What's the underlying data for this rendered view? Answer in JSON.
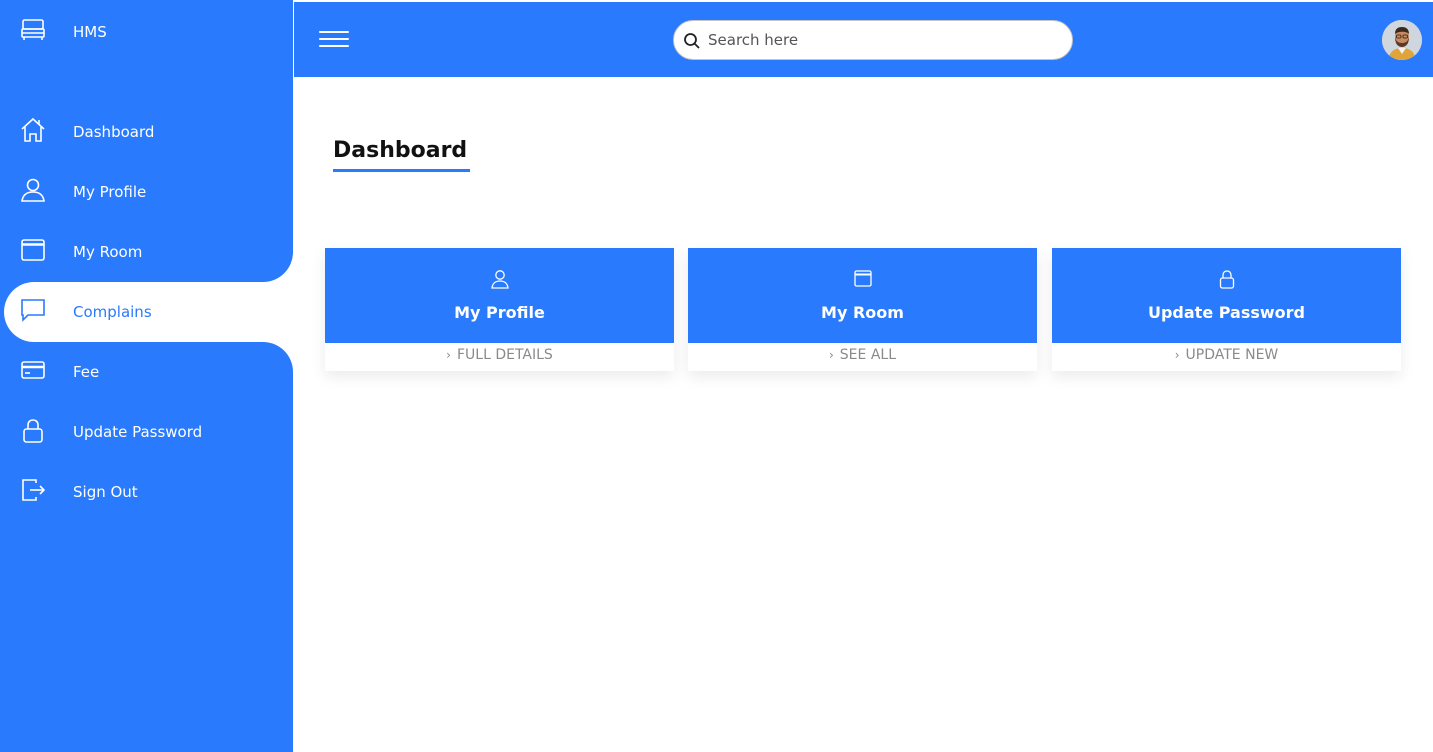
{
  "sidebar": {
    "brand": {
      "label": "HMS",
      "icon": "bed-icon"
    },
    "items": [
      {
        "label": "Dashboard",
        "icon": "home-icon"
      },
      {
        "label": "My Profile",
        "icon": "person-icon"
      },
      {
        "label": "My Room",
        "icon": "window-icon"
      },
      {
        "label": "Complains",
        "icon": "chat-icon",
        "active": true
      },
      {
        "label": "Fee",
        "icon": "credit-card-icon"
      },
      {
        "label": "Update Password",
        "icon": "lock-icon"
      },
      {
        "label": "Sign Out",
        "icon": "sign-out-icon"
      }
    ]
  },
  "topbar": {
    "search": {
      "placeholder": "Search here"
    }
  },
  "main": {
    "title": "Dashboard",
    "cards": [
      {
        "title": "My Profile",
        "link": "FULL DETAILS",
        "icon": "person-icon"
      },
      {
        "title": "My Room",
        "link": "SEE ALL",
        "icon": "window-icon"
      },
      {
        "title": "Update Password",
        "link": "UPDATE NEW",
        "icon": "lock-icon"
      }
    ]
  },
  "colors": {
    "accent": "#2a7afe",
    "link_text": "#8a8a8a"
  }
}
